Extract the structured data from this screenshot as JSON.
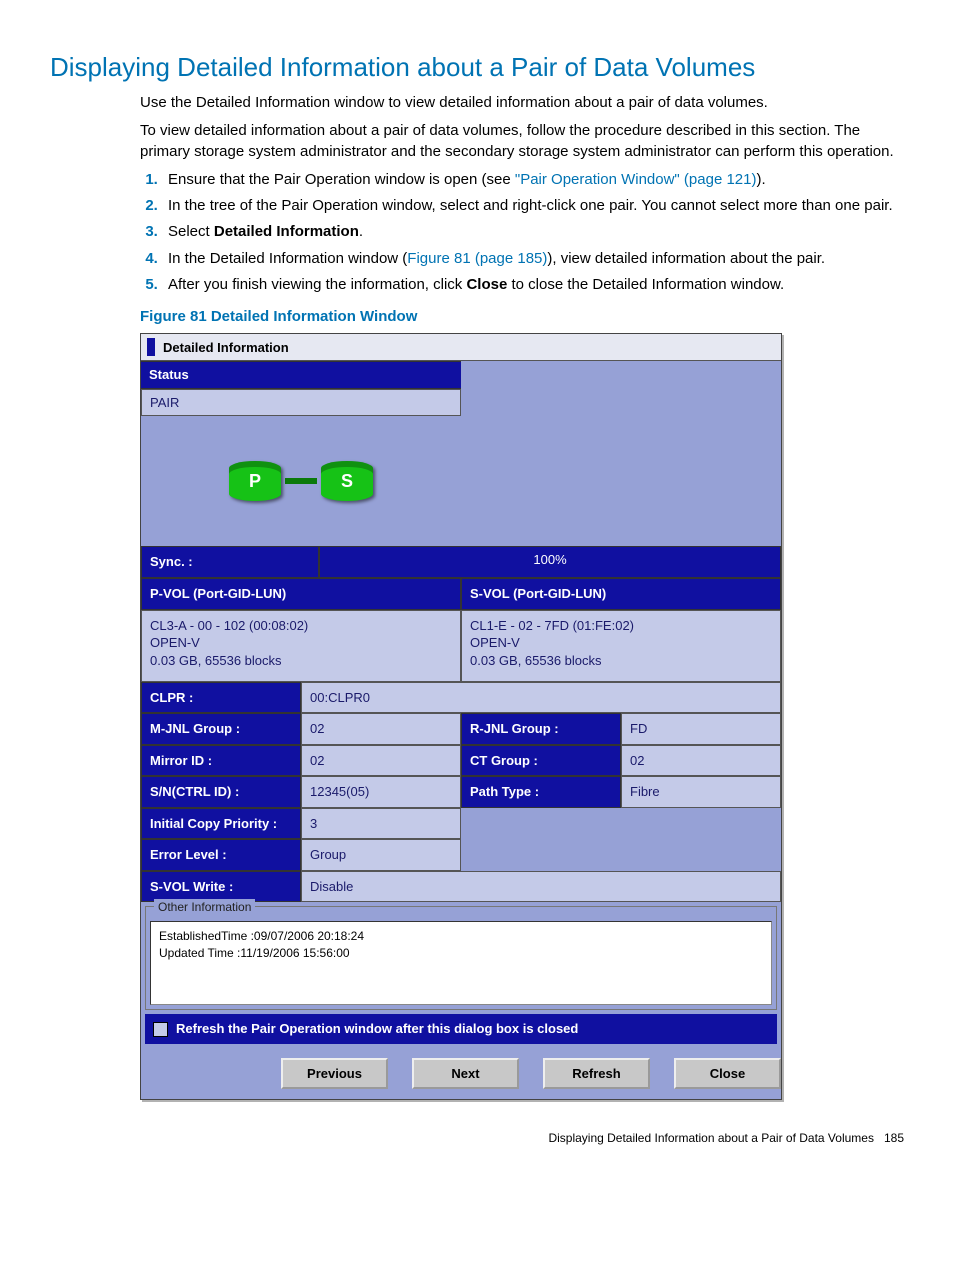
{
  "heading": "Displaying Detailed Information about a Pair of Data Volumes",
  "intro1": "Use the Detailed Information window to view detailed information about a pair of data volumes.",
  "intro2": "To view detailed information about a pair of data volumes, follow the procedure described in this section. The primary storage system administrator and the secondary storage system administrator can perform this operation.",
  "steps": {
    "s1a": "Ensure that the Pair Operation window is open (see ",
    "s1link": "\"Pair Operation Window\" (page 121)",
    "s1b": ").",
    "s2": "In the tree of the Pair Operation window, select and right-click one pair. You cannot select more than one pair.",
    "s3a": "Select ",
    "s3b": "Detailed Information",
    "s3c": ".",
    "s4a": "In the Detailed Information window (",
    "s4link": "Figure 81 (page 185)",
    "s4b": "), view detailed information about the pair.",
    "s5a": "After you finish viewing the information, click ",
    "s5b": "Close",
    "s5c": " to close the Detailed Information window."
  },
  "figcap": "Figure 81 Detailed Information Window",
  "win": {
    "title": "Detailed Information",
    "status_hdr": "Status",
    "status_val": "PAIR",
    "p": "P",
    "s": "S",
    "sync_lbl": "Sync. :",
    "sync_val": "100%",
    "pvol_hdr": "P-VOL (Port-GID-LUN)",
    "svol_hdr": "S-VOL (Port-GID-LUN)",
    "pvol_l1": "CL3-A - 00 - 102 (00:08:02)",
    "pvol_l2": "OPEN-V",
    "pvol_l3": "0.03 GB, 65536 blocks",
    "svol_l1": "CL1-E - 02 - 7FD (01:FE:02)",
    "svol_l2": "OPEN-V",
    "svol_l3": "0.03 GB, 65536 blocks",
    "clpr_lbl": "CLPR :",
    "clpr_val": "00:CLPR0",
    "mjnl_lbl": "M-JNL Group :",
    "mjnl_val": "02",
    "rjnl_lbl": "R-JNL Group :",
    "rjnl_val": "FD",
    "mir_lbl": "Mirror ID :",
    "mir_val": "02",
    "ct_lbl": "CT Group :",
    "ct_val": "02",
    "sn_lbl": "S/N(CTRL ID) :",
    "sn_val": "12345(05)",
    "path_lbl": "Path Type :",
    "path_val": "Fibre",
    "icp_lbl": "Initial Copy Priority :",
    "icp_val": "3",
    "err_lbl": "Error Level :",
    "err_val": "Group",
    "svw_lbl": "S-VOL Write :",
    "svw_val": "Disable",
    "other_legend": "Other Information",
    "other_l1": "EstablishedTime :09/07/2006 20:18:24",
    "other_l2": "Updated Time :11/19/2006 15:56:00",
    "refresh_txt": "Refresh the Pair Operation window after this dialog box is closed",
    "btn_prev": "Previous",
    "btn_next": "Next",
    "btn_refresh": "Refresh",
    "btn_close": "Close"
  },
  "footer_txt": "Displaying Detailed Information about a Pair of Data Volumes",
  "footer_pg": "185"
}
